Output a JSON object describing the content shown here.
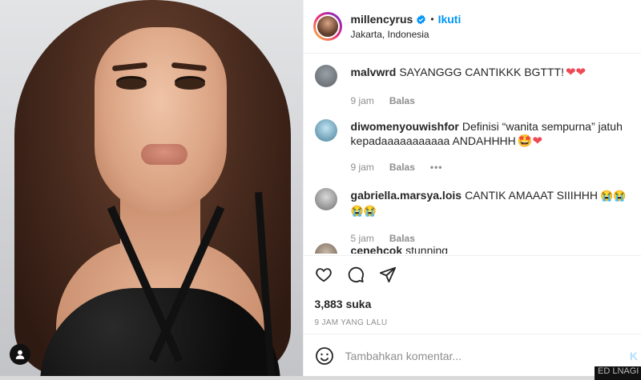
{
  "post": {
    "username": "millencyrus",
    "follow_label": "Ikuti",
    "separator": "•",
    "location": "Jakarta, Indonesia",
    "verified_icon": "verified-badge-icon"
  },
  "comments": [
    {
      "user": "malvwrd",
      "text": "SAYANGGG CANTIKKK BGTTT!",
      "suffix": "❤❤",
      "time": "9 jam",
      "reply": "Balas"
    },
    {
      "user": "diwomenyouwishfor",
      "text": "Definisi “wanita sempurna” jatuh kepadaaaaaaaaaaa ANDAHHHH",
      "suffix": "🤩❤",
      "time": "9 jam",
      "reply": "Balas",
      "more": "•••"
    },
    {
      "user": "gabriella.marsya.lois",
      "text": "CANTIK AMAAAT SIIIHHH",
      "suffix": "😭😭😭😭",
      "time": "5 jam",
      "reply": "Balas"
    },
    {
      "user": "cenehcok",
      "text": "stunning"
    }
  ],
  "engagement": {
    "likes": "3,883 suka",
    "posted": "9 JAM YANG LALU"
  },
  "composer": {
    "placeholder": "Tambahkan komentar...",
    "post_label": "K"
  },
  "background_text": "ED LNAGI"
}
